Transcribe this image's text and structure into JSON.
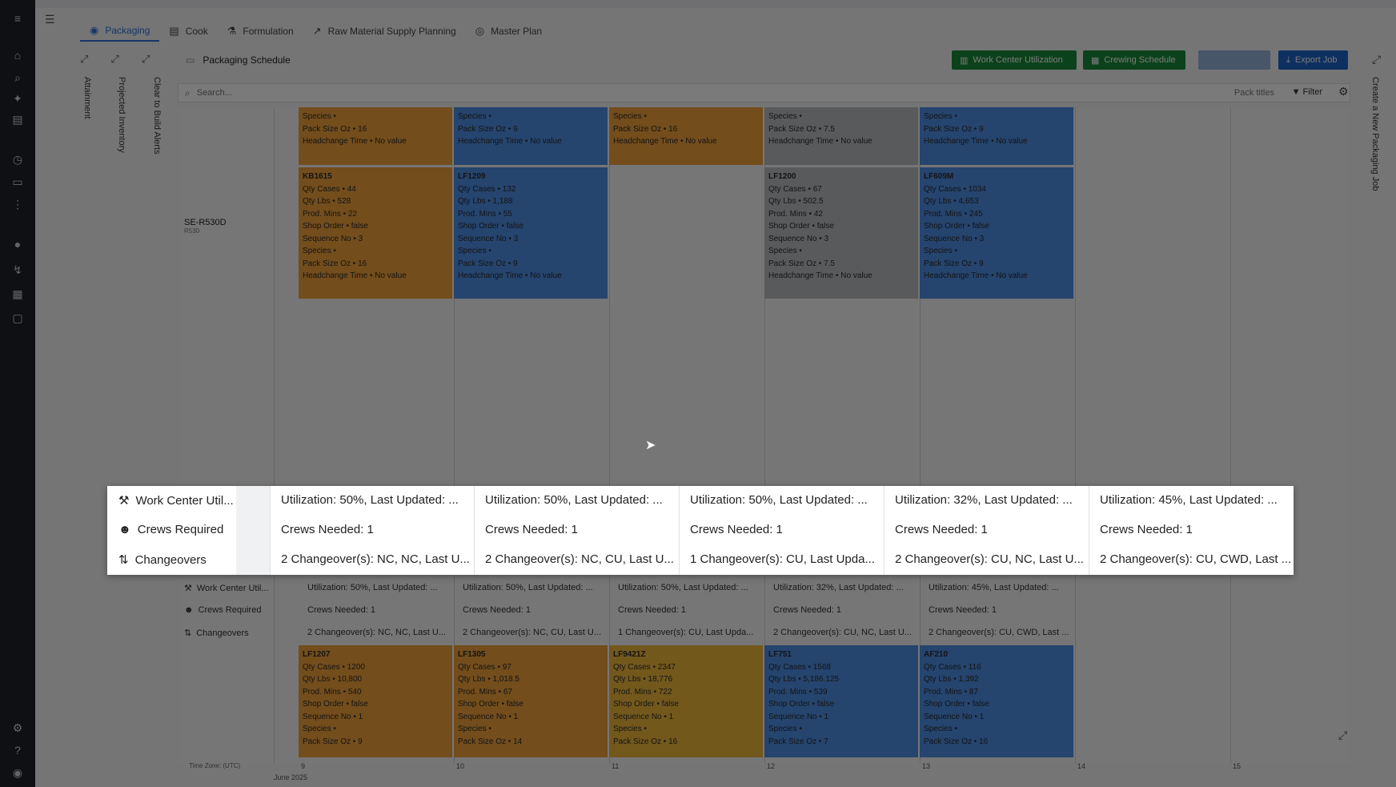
{
  "nav": {
    "tabs": [
      {
        "label": "Packaging",
        "icon": "cube-icon"
      },
      {
        "label": "Cook",
        "icon": "book-icon"
      },
      {
        "label": "Formulation",
        "icon": "flask-icon"
      },
      {
        "label": "Raw Material Supply Planning",
        "icon": "chart-icon"
      },
      {
        "label": "Master Plan",
        "icon": "target-icon"
      }
    ]
  },
  "header": {
    "breadcrumb": "Packaging Schedule",
    "buttons": {
      "work_center_utilization": "Work Center Utilization",
      "crewing_schedule": "Crewing Schedule",
      "export_job": "Export Job"
    }
  },
  "vertical_labels": {
    "attainment": "Attainment",
    "projected_inventory": "Projected Inventory",
    "clear_to_build": "Clear to Build Alerts",
    "create_job": "Create a New Packaging Job"
  },
  "search": {
    "placeholder": "Search...",
    "pack_titles": "Pack titles",
    "filter": "Filter"
  },
  "row_label": {
    "name": "SE-R530D",
    "sub": "R530"
  },
  "top_cards": [
    {
      "color": "orange",
      "lines": [
        "Species •",
        "Pack Size Oz • 16",
        "Headchange Time • No value"
      ]
    },
    {
      "color": "blue",
      "lines": [
        "Species •",
        "Pack Size Oz • 9",
        "Headchange Time • No value"
      ]
    },
    {
      "color": "orange",
      "lines": [
        "Species •",
        "Pack Size Oz • 16",
        "Headchange Time • No value"
      ]
    },
    {
      "color": "gray",
      "lines": [
        "Species •",
        "Pack Size Oz • 7.5",
        "Headchange Time • No value"
      ]
    },
    {
      "color": "blue",
      "lines": [
        "Species •",
        "Pack Size Oz • 9",
        "Headchange Time • No value"
      ]
    }
  ],
  "mid_cards": [
    {
      "color": "orange",
      "id": "KB1615",
      "lines": [
        "Qty Cases • 44",
        "Qty Lbs • 528",
        "Prod. Mins • 22",
        "Shop Order • false",
        "Sequence No • 3",
        "Species •",
        "Pack Size Oz • 16",
        "Headchange Time • No value"
      ]
    },
    {
      "color": "blue",
      "id": "LF1209",
      "lines": [
        "Qty Cases • 132",
        "Qty Lbs • 1,188",
        "Prod. Mins • 55",
        "Shop Order • false",
        "Sequence No • 3",
        "Species •",
        "Pack Size Oz • 9",
        "Headchange Time • No value"
      ]
    },
    null,
    {
      "color": "gray",
      "id": "LF1200",
      "lines": [
        "Qty Cases • 67",
        "Qty Lbs • 502.5",
        "Prod. Mins • 42",
        "Shop Order • false",
        "Sequence No • 3",
        "Species •",
        "Pack Size Oz • 7.5",
        "Headchange Time • No value"
      ]
    },
    {
      "color": "blue",
      "id": "LF609M",
      "lines": [
        "Qty Cases • 1034",
        "Qty Lbs • 4,653",
        "Prod. Mins • 245",
        "Shop Order • false",
        "Sequence No • 3",
        "Species •",
        "Pack Size Oz • 9",
        "Headchange Time • No value"
      ]
    }
  ],
  "bottom_cards": [
    {
      "color": "orange",
      "id": "LF1207",
      "lines": [
        "Qty Cases • 1200",
        "Qty Lbs • 10,800",
        "Prod. Mins • 540",
        "Shop Order • false",
        "Sequence No • 1",
        "Species •",
        "Pack Size Oz • 9"
      ]
    },
    {
      "color": "orange",
      "id": "LF1305",
      "lines": [
        "Qty Cases • 97",
        "Qty Lbs • 1,018.5",
        "Prod. Mins • 67",
        "Shop Order • false",
        "Sequence No • 1",
        "Species •",
        "Pack Size Oz • 14"
      ]
    },
    {
      "color": "yellow",
      "id": "LF9421Z",
      "lines": [
        "Qty Cases • 2347",
        "Qty Lbs • 18,776",
        "Prod. Mins • 722",
        "Shop Order • false",
        "Sequence No • 1",
        "Species •",
        "Pack Size Oz • 16"
      ]
    },
    {
      "color": "blue",
      "id": "LF751",
      "lines": [
        "Qty Cases • 1568",
        "Qty Lbs • 5,186.125",
        "Prod. Mins • 539",
        "Shop Order • false",
        "Sequence No • 1",
        "Species •",
        "Pack Size Oz • 7"
      ]
    },
    {
      "color": "blue",
      "id": "AF210",
      "lines": [
        "Qty Cases • 116",
        "Qty Lbs • 1,392",
        "Prod. Mins • 87",
        "Shop Order • false",
        "Sequence No • 1",
        "Species •",
        "Pack Size Oz • 16"
      ]
    }
  ],
  "summary": {
    "labels": {
      "work_center": "Work Center Util...",
      "crews": "Crews Required",
      "changeovers": "Changeovers"
    },
    "utilization": [
      "Utilization: 50%, Last Updated: ...",
      "Utilization: 50%, Last Updated: ...",
      "Utilization: 50%, Last Updated: ...",
      "Utilization: 32%, Last Updated: ...",
      "Utilization: 45%, Last Updated: ..."
    ],
    "crews": [
      "Crews Needed: 1",
      "Crews Needed: 1",
      "Crews Needed: 1",
      "Crews Needed: 1",
      "Crews Needed: 1"
    ],
    "changeovers": [
      "2 Changeover(s): NC, NC, Last U...",
      "2 Changeover(s): NC, CU, Last U...",
      "1 Changeover(s): CU, Last Upda...",
      "2 Changeover(s): CU, NC, Last U...",
      "2 Changeover(s): CU, CWD, Last ..."
    ]
  },
  "axis": {
    "ticks": [
      "9",
      "10",
      "11",
      "12",
      "13",
      "14",
      "15"
    ],
    "month": "June 2025",
    "timezone": "Time Zone: (UTC)"
  }
}
